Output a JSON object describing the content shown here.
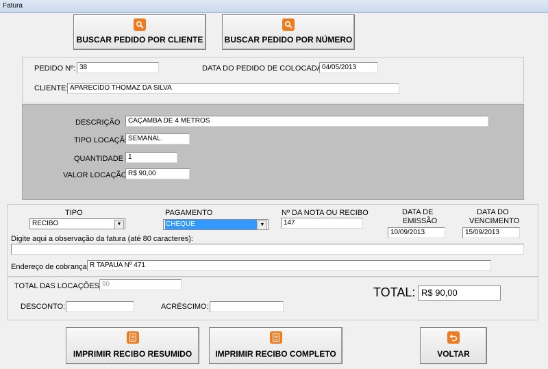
{
  "window": {
    "title": "Fatura"
  },
  "top_buttons": {
    "by_client": "BUSCAR PEDIDO POR CLIENTE",
    "by_number": "BUSCAR PEDIDO POR NÚMERO"
  },
  "order": {
    "number_label": "PEDIDO Nº:",
    "number_value": "38",
    "date_label": "DATA DO PEDIDO DE COLOCADA:",
    "date_value": "04/05/2013",
    "client_label": "CLIENTE:",
    "client_value": "APARECIDO THOMAZ DA SILVA"
  },
  "item": {
    "description_label": "DESCRIÇÃO",
    "description_value": "CAÇAMBA DE 4 METROS",
    "type_label": "TIPO LOCAÇÃO",
    "type_value": "SEMANAL",
    "quantity_label": "QUANTIDADE",
    "quantity_value": "1",
    "value_label": "VALOR LOCAÇÃO",
    "value_value": "R$ 90,00"
  },
  "invoice": {
    "tipo_label": "TIPO",
    "tipo_value": "RECIBO",
    "payment_label": "PAGAMENTO",
    "payment_value": "CHEQUE",
    "receipt_label": "Nº DA NOTA OU RECIBO",
    "receipt_value": "147",
    "emission_label_1": "DATA DE",
    "emission_label_2": "EMISSÃO",
    "emission_value": "10/09/2013",
    "due_label_1": "DATA DO",
    "due_label_2": "VENCIMENTO",
    "due_value": "15/09/2013",
    "obs_label": "Digite aqui a observação da fatura (até 80 caracteres):",
    "obs_value": "",
    "address_label": "Endereço de cobrança",
    "address_value": "R TAPAUA Nº 471"
  },
  "totals": {
    "rentals_label": "TOTAL DAS LOCAÇÕES:",
    "rentals_value": "90",
    "discount_label": "DESCONTO:",
    "discount_value": "",
    "surcharge_label": "ACRÉSCIMO:",
    "surcharge_value": "",
    "total_label": "TOTAL:",
    "total_value": "R$ 90,00"
  },
  "bottom_buttons": {
    "print_summary": "IMPRIMIR RECIBO RESUMIDO",
    "print_full": "IMPRIMIR RECIBO COMPLETO",
    "back": "VOLTAR"
  },
  "icons": {
    "search": "search-icon",
    "document": "document-icon",
    "back": "back-arrow-icon"
  },
  "colors": {
    "accent": "#f07a1e",
    "selection": "#3399ff",
    "gray_panel": "#c0c0c0"
  }
}
